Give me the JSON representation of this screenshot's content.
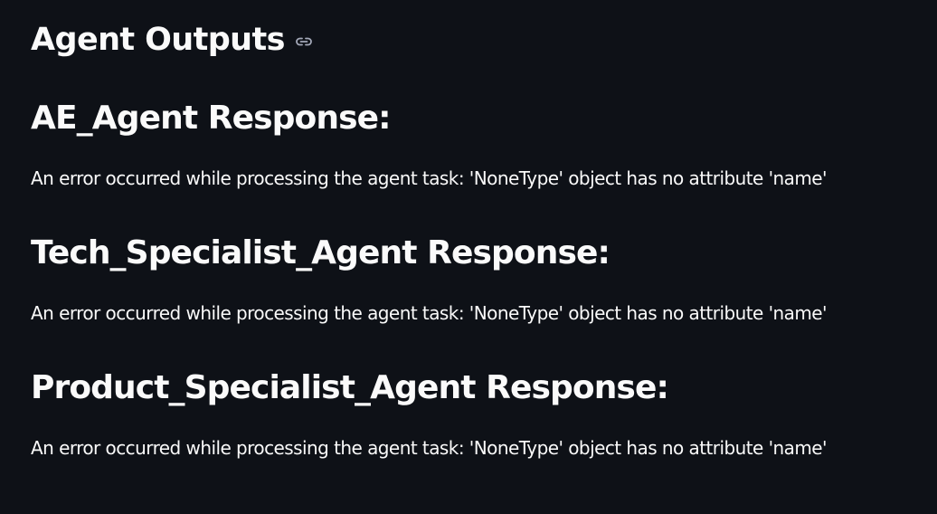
{
  "page": {
    "title": "Agent Outputs",
    "link_icon": "link-icon"
  },
  "sections": [
    {
      "heading": "AE_Agent Response:",
      "body": "An error occurred while processing the agent task: 'NoneType' object has no attribute 'name'"
    },
    {
      "heading": "Tech_Specialist_Agent Response:",
      "body": "An error occurred while processing the agent task: 'NoneType' object has no attribute 'name'"
    },
    {
      "heading": "Product_Specialist_Agent Response:",
      "body": "An error occurred while processing the agent task: 'NoneType' object has no attribute 'name'"
    }
  ],
  "colors": {
    "background": "#0e1117",
    "text": "#fafafa",
    "icon": "#a3a8b8"
  }
}
